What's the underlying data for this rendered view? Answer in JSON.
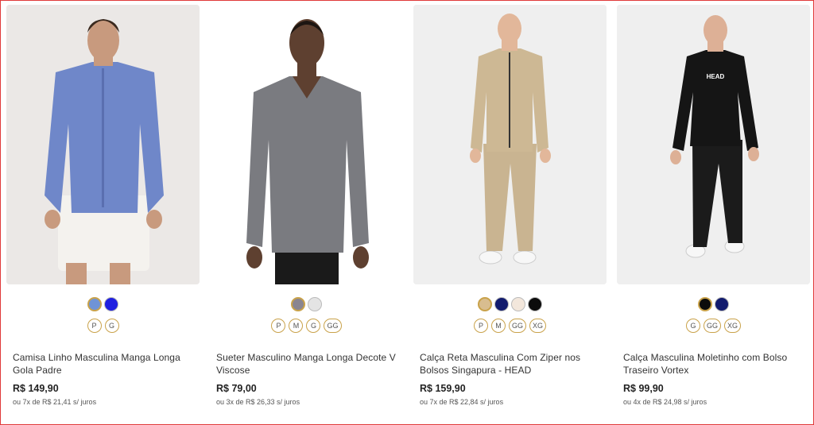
{
  "products": [
    {
      "name": "Camisa Linho Masculina Manga Longa Gola Padre",
      "price": "R$ 149,90",
      "installments": "ou 7x de R$ 21,41 s/ juros",
      "image_alt": "Homem vestindo camisa de linho azul e bermuda branca",
      "colors": [
        "#6f93d6",
        "#1f1fe0"
      ],
      "sizes": [
        "P",
        "G"
      ]
    },
    {
      "name": "Sueter Masculino Manga Longa Decote V Viscose",
      "price": "R$ 79,00",
      "installments": "ou 3x de R$ 26,33 s/ juros",
      "image_alt": "Homem vestindo suéter cinza decote V",
      "colors": [
        "#8a8590",
        "#e4e4e4"
      ],
      "sizes": [
        "P",
        "M",
        "G",
        "GG"
      ]
    },
    {
      "name": "Calça Reta Masculina Com Ziper nos Bolsos Singapura - HEAD",
      "price": "R$ 159,90",
      "installments": "ou 7x de R$ 22,84 s/ juros",
      "image_alt": "Homem vestindo conjunto bege com zíper",
      "colors": [
        "#d8bd8f",
        "#121b6e",
        "#f3e7dc",
        "#0c0c0c"
      ],
      "sizes": [
        "P",
        "M",
        "GG",
        "XG"
      ]
    },
    {
      "name": "Calça Masculina Moletinho com Bolso Traseiro Vortex",
      "price": "R$ 99,90",
      "installments": "ou 4x de R$ 24,98 s/ juros",
      "image_alt": "Homem vestindo blusa preta HEAD e calça de moletom preta",
      "logo_text": "HEAD",
      "colors": [
        "#0c0c0c",
        "#121b6e"
      ],
      "sizes": [
        "G",
        "GG",
        "XG"
      ]
    }
  ]
}
